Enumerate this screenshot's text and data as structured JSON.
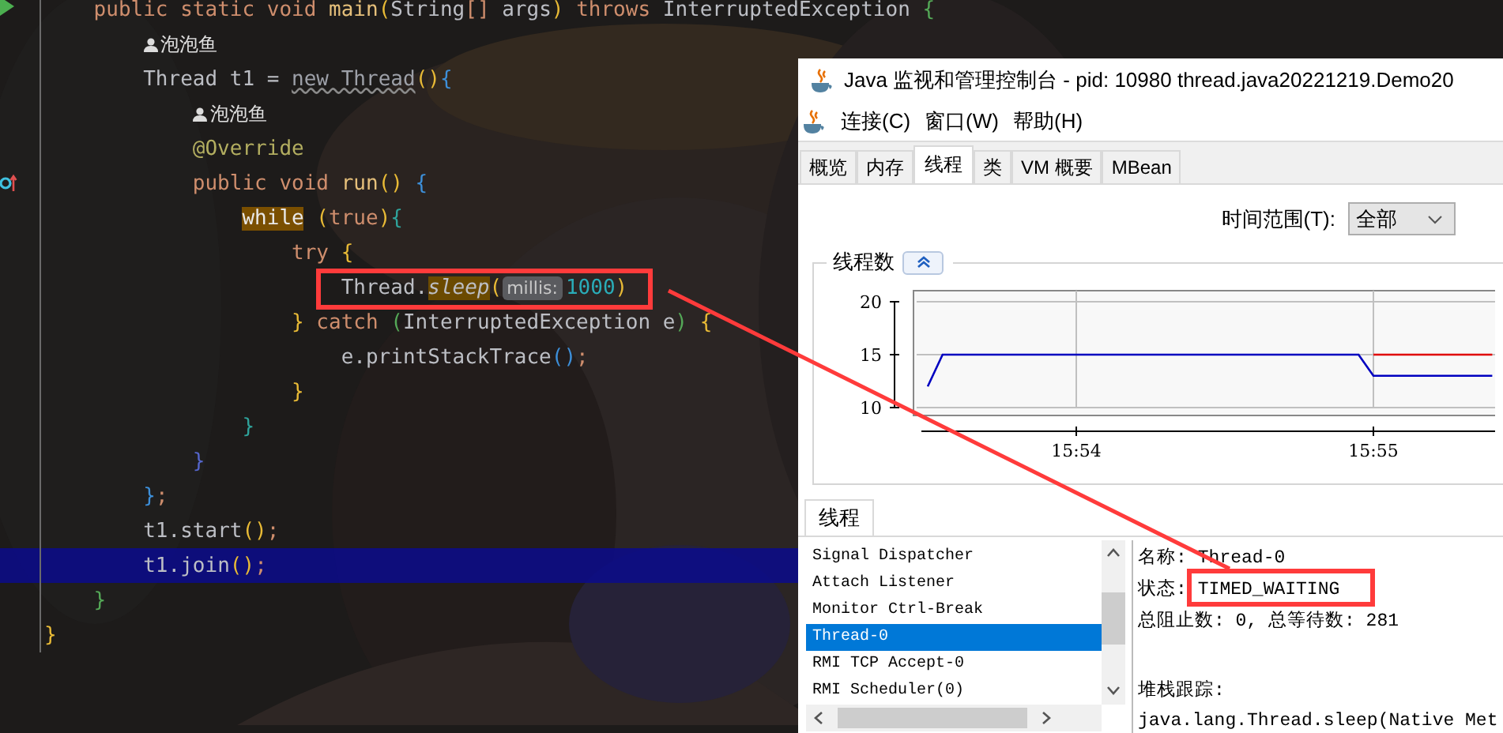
{
  "editor": {
    "lines": [
      {
        "kind": "group",
        "children": [
          {
            "kind": "code",
            "gutter": {
              "kind": "run"
            },
            "highlighted": false,
            "tokens": [
              {
                "text": "public static void ",
                "kind": "keyword"
              },
              {
                "text": "main",
                "kind": "method"
              },
              {
                "text": "(",
                "kind": "bracket-gold"
              },
              {
                "text": "String",
                "kind": "plain"
              },
              {
                "text": "[]",
                "kind": "bracket-orange"
              },
              {
                "text": " args",
                "kind": "plain"
              },
              {
                "text": ")",
                "kind": "bracket-gold"
              },
              {
                "text": " throws ",
                "kind": "keyword"
              },
              {
                "text": "InterruptedException ",
                "kind": "plain"
              },
              {
                "text": "{",
                "kind": "bracket-green"
              }
            ],
            "children": [
              {
                "kind": "author",
                "highlighted": false,
                "author": "泡泡鱼"
              },
              {
                "kind": "code",
                "highlighted": false,
                "tokens": [
                  {
                    "text": "Thread t1 = ",
                    "kind": "plain"
                  },
                  {
                    "text": "new Thread",
                    "kind": "ctor"
                  },
                  {
                    "text": "()",
                    "kind": "bracket-gold"
                  },
                  {
                    "text": "{",
                    "kind": "bracket-blue"
                  }
                ],
                "children": [
                  {
                    "kind": "author",
                    "highlighted": false,
                    "author": "泡泡鱼"
                  },
                  {
                    "kind": "code",
                    "highlighted": false,
                    "tokens": [
                      {
                        "text": "@Override",
                        "kind": "annotation"
                      }
                    ]
                  },
                  {
                    "kind": "code",
                    "gutter": {
                      "kind": "override"
                    },
                    "highlighted": false,
                    "tokens": [
                      {
                        "text": "public void ",
                        "kind": "keyword"
                      },
                      {
                        "text": "run",
                        "kind": "method"
                      },
                      {
                        "text": "()",
                        "kind": "bracket-gold"
                      },
                      {
                        "text": " {",
                        "kind": "bracket-blue"
                      }
                    ],
                    "children": [
                      {
                        "kind": "code",
                        "highlighted": false,
                        "tokens": [
                          {
                            "text": "while",
                            "kind": "keyword-hl"
                          },
                          {
                            "text": " (",
                            "kind": "bracket-gold"
                          },
                          {
                            "text": "true",
                            "kind": "keyword"
                          },
                          {
                            "text": ")",
                            "kind": "bracket-gold"
                          },
                          {
                            "text": "{",
                            "kind": "bracket-teal"
                          }
                        ],
                        "children": [
                          {
                            "kind": "code",
                            "highlighted": false,
                            "tokens": [
                              {
                                "text": "try ",
                                "kind": "keyword"
                              },
                              {
                                "text": "{",
                                "kind": "bracket-gold"
                              }
                            ],
                            "children": [
                              {
                                "kind": "code",
                                "highlighted": false,
                                "tokens": [
                                  {
                                    "text": "Thread.",
                                    "kind": "plain"
                                  },
                                  {
                                    "text": "sleep",
                                    "kind": "static-call"
                                  },
                                  {
                                    "text": "(",
                                    "kind": "bracket-gold"
                                  },
                                  {
                                    "text": "millis:",
                                    "kind": "hint"
                                  },
                                  {
                                    "text": "1000",
                                    "kind": "number"
                                  },
                                  {
                                    "text": ")",
                                    "kind": "bracket-gold"
                                  }
                                ]
                              }
                            ]
                          },
                          {
                            "kind": "code",
                            "highlighted": false,
                            "tokens": [
                              {
                                "text": "}",
                                "kind": "bracket-gold"
                              },
                              {
                                "text": " catch ",
                                "kind": "keyword"
                              },
                              {
                                "text": "(",
                                "kind": "bracket-green"
                              },
                              {
                                "text": "InterruptedException e",
                                "kind": "plain"
                              },
                              {
                                "text": ")",
                                "kind": "bracket-green"
                              },
                              {
                                "text": " {",
                                "kind": "bracket-gold"
                              }
                            ],
                            "children": [
                              {
                                "kind": "code",
                                "highlighted": false,
                                "tokens": [
                                  {
                                    "text": "e.printStackTrace",
                                    "kind": "plain"
                                  },
                                  {
                                    "text": "()",
                                    "kind": "bracket-blue"
                                  },
                                  {
                                    "text": ";",
                                    "kind": "keyword"
                                  }
                                ]
                              }
                            ]
                          },
                          {
                            "kind": "code",
                            "highlighted": false,
                            "tokens": [
                              {
                                "text": "}",
                                "kind": "bracket-gold"
                              }
                            ]
                          }
                        ]
                      },
                      {
                        "kind": "code",
                        "highlighted": false,
                        "tokens": [
                          {
                            "text": "}",
                            "kind": "bracket-teal"
                          }
                        ]
                      }
                    ]
                  },
                  {
                    "kind": "code",
                    "highlighted": false,
                    "tokens": [
                      {
                        "text": "}",
                        "kind": "bracket-purple"
                      }
                    ]
                  }
                ]
              },
              {
                "kind": "code",
                "highlighted": false,
                "tokens": [
                  {
                    "text": "}",
                    "kind": "bracket-blue"
                  },
                  {
                    "text": ";",
                    "kind": "keyword"
                  }
                ]
              },
              {
                "kind": "code",
                "highlighted": false,
                "tokens": [
                  {
                    "text": "t1.start",
                    "kind": "plain"
                  },
                  {
                    "text": "()",
                    "kind": "bracket-gold"
                  },
                  {
                    "text": ";",
                    "kind": "keyword"
                  }
                ]
              },
              {
                "kind": "code",
                "highlighted": true,
                "tokens": [
                  {
                    "text": "t1.join",
                    "kind": "plain"
                  },
                  {
                    "text": "()",
                    "kind": "bracket-gold"
                  },
                  {
                    "text": ";",
                    "kind": "keyword"
                  }
                ]
              }
            ]
          },
          {
            "kind": "code",
            "highlighted": false,
            "tokens": [
              {
                "text": "}",
                "kind": "bracket-green"
              }
            ]
          }
        ]
      },
      {
        "kind": "code",
        "highlighted": false,
        "tokens": [
          {
            "text": "}",
            "kind": "bracket-gold"
          }
        ]
      }
    ]
  },
  "monitor_window": {
    "title": "Java 监视和管理控制台 - pid: 10980 thread.java20221219.Demo20",
    "menu": [
      "连接(C)",
      "窗口(W)",
      "帮助(H)"
    ],
    "tabs": [
      {
        "label": "概览",
        "selected": false
      },
      {
        "label": "内存",
        "selected": false
      },
      {
        "label": "线程",
        "selected": true
      },
      {
        "label": "类",
        "selected": false
      },
      {
        "label": "VM 概要",
        "selected": false
      },
      {
        "label": "MBean",
        "selected": false
      }
    ],
    "time_range": {
      "label": "时间范围(T):",
      "value": "全部"
    },
    "thread_count": {
      "title": "线程数",
      "chart_data": {
        "type": "line",
        "grid": true,
        "categories": [
          null,
          null,
          null,
          null,
          null,
          null,
          null,
          null,
          null,
          null,
          "15:54",
          null,
          null,
          null,
          null,
          null,
          null,
          null,
          null,
          null,
          null,
          null,
          null,
          null,
          null,
          null,
          null,
          null,
          null,
          null,
          "15:55",
          null,
          null,
          null,
          null,
          null,
          null,
          null,
          null
        ],
        "ylim": [
          10,
          20
        ],
        "yticks": [
          10,
          15,
          20
        ],
        "series": [
          {
            "color": "#e00000",
            "values": [
              null,
              null,
              null,
              null,
              null,
              null,
              null,
              null,
              null,
              null,
              null,
              null,
              null,
              null,
              null,
              null,
              null,
              null,
              null,
              null,
              null,
              null,
              null,
              null,
              null,
              null,
              null,
              null,
              null,
              null,
              15,
              15,
              15,
              15,
              15,
              15,
              15,
              15,
              15
            ]
          },
          {
            "color": "#0000c0",
            "values": [
              12,
              15,
              15,
              15,
              15,
              15,
              15,
              15,
              15,
              15,
              15,
              15,
              15,
              15,
              15,
              15,
              15,
              15,
              15,
              15,
              15,
              15,
              15,
              15,
              15,
              15,
              15,
              15,
              15,
              15,
              13,
              13,
              13,
              13,
              13,
              13,
              13,
              13,
              13
            ]
          }
        ]
      }
    },
    "threads": {
      "tab": "线程",
      "items": [
        {
          "name": "Signal Dispatcher",
          "selected": false
        },
        {
          "name": "Attach Listener",
          "selected": false
        },
        {
          "name": "Monitor Ctrl-Break",
          "selected": false
        },
        {
          "name": "Thread-0",
          "selected": true
        },
        {
          "name": "RMI TCP Accept-0",
          "selected": false
        },
        {
          "name": "RMI Scheduler(0)",
          "selected": false
        }
      ],
      "details": [
        {
          "label": "名称:",
          "value": "Thread-0"
        },
        {
          "label": "状态:",
          "value": "TIMED_WAITING"
        },
        {
          "label": "总阻止数: 0, 总等待数: 281"
        }
      ],
      "stack_label": "堆栈跟踪:",
      "stack": [
        "java.lang.Thread.sleep(Native Met"
      ]
    }
  }
}
